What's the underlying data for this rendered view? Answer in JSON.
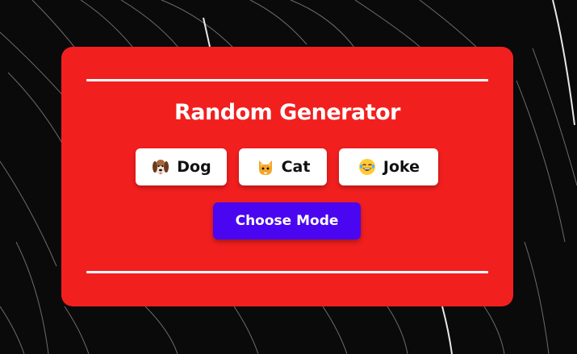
{
  "app": {
    "title": "Random Generator"
  },
  "modes": {
    "dog": {
      "label": "Dog",
      "icon": "dog-face-icon"
    },
    "cat": {
      "label": "Cat",
      "icon": "cat-face-icon"
    },
    "joke": {
      "label": "Joke",
      "icon": "laughing-face-icon"
    }
  },
  "actions": {
    "choose_label": "Choose Mode"
  },
  "colors": {
    "card": "#f21f1f",
    "primary_button": "#4a06f0",
    "mode_button": "#ffffff",
    "background": "#0a0a0a"
  }
}
